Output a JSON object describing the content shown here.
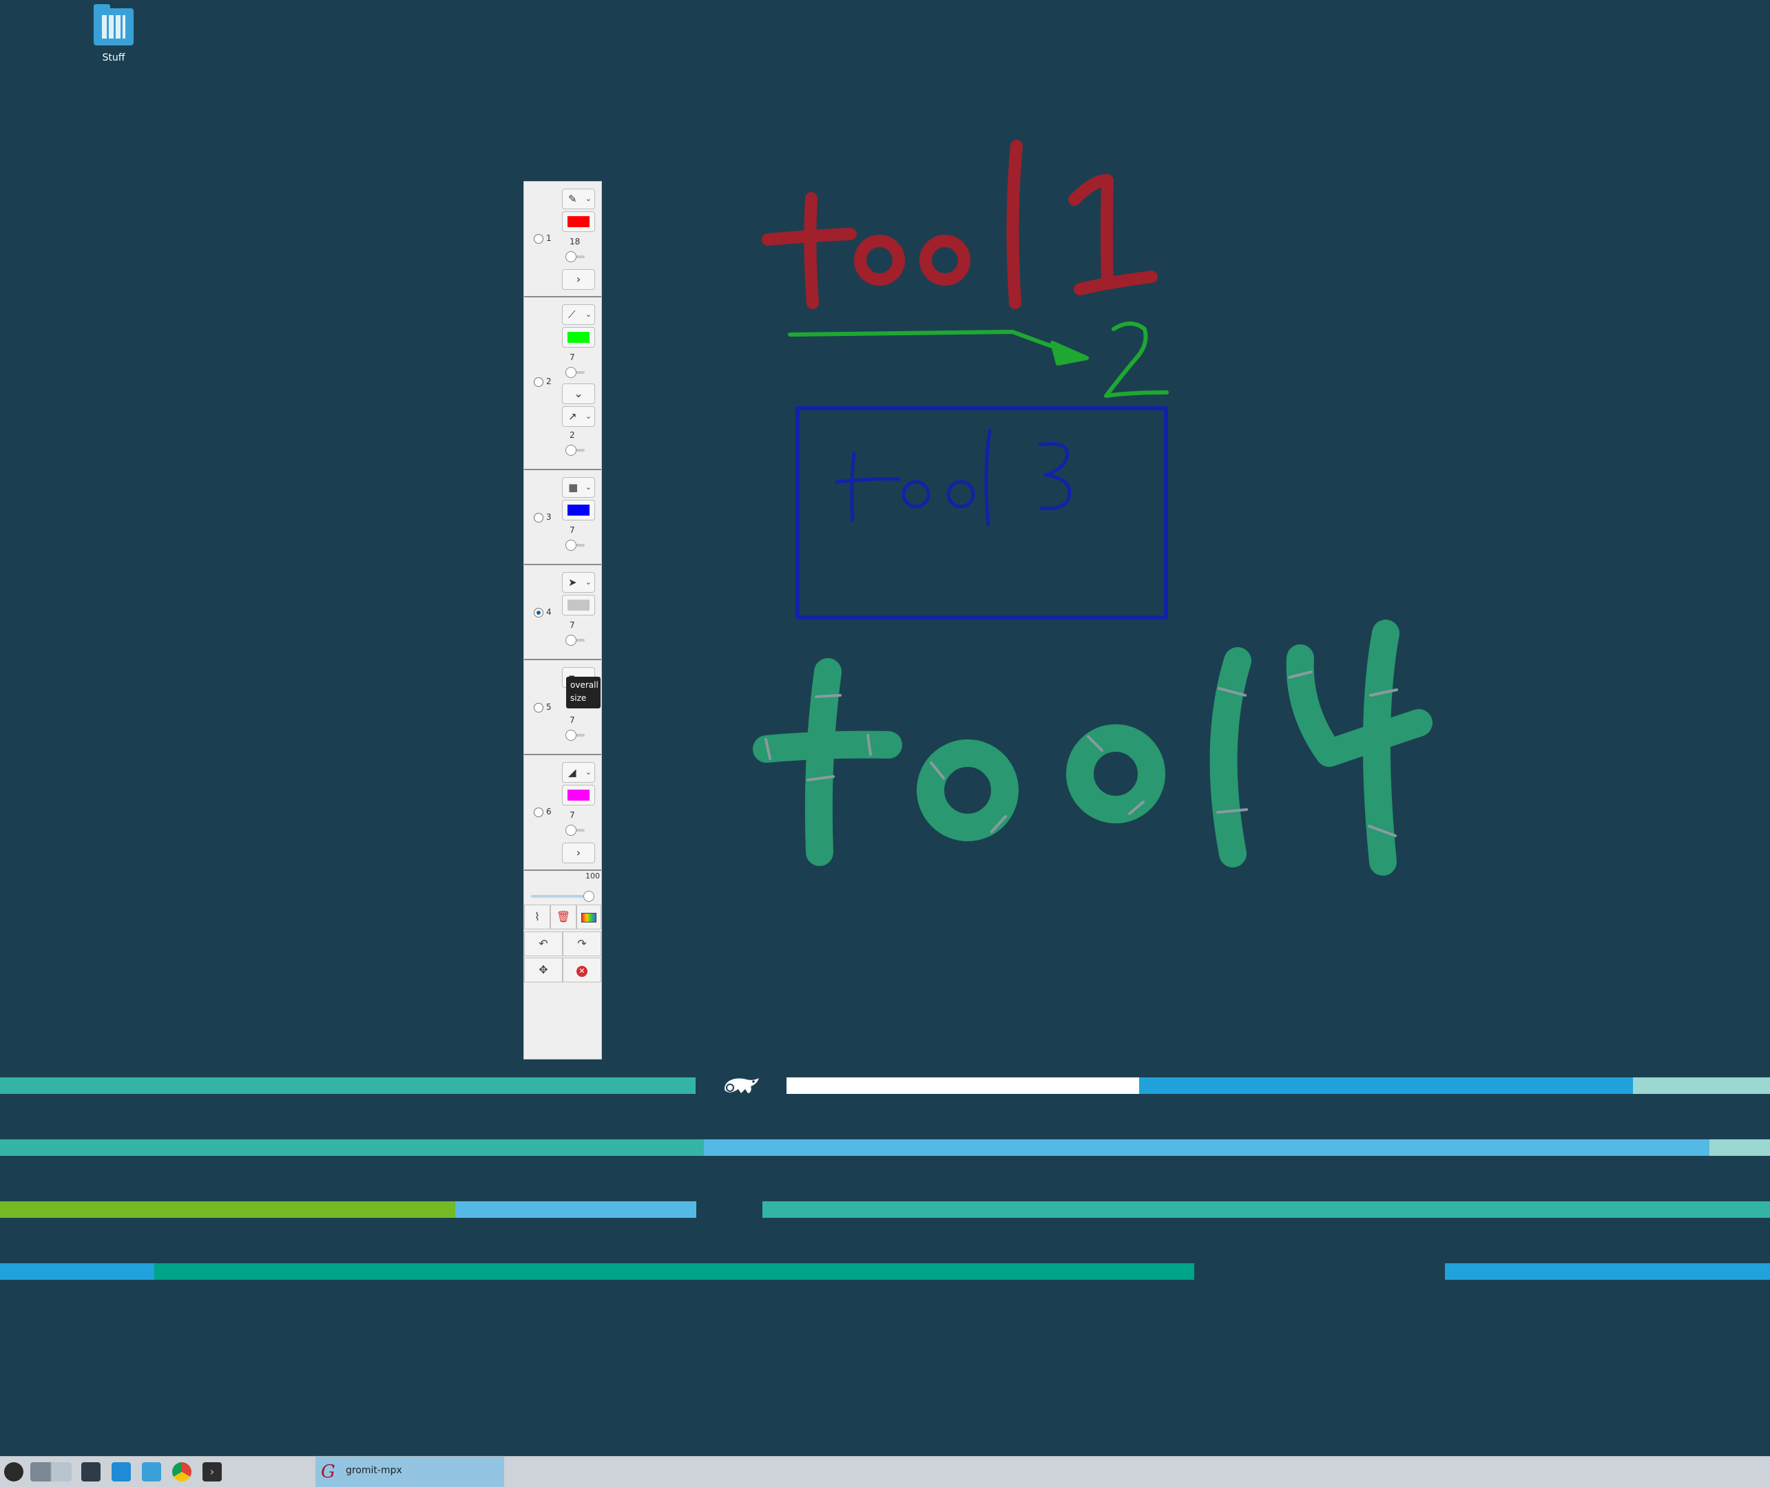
{
  "desktop": {
    "icons": [
      {
        "label": "Stuff",
        "icon": "folder-icon"
      }
    ]
  },
  "drawing": {
    "annotations": [
      {
        "text": "tool1",
        "color": "#a0202c"
      },
      {
        "text": "2",
        "color": "#1ea832"
      },
      {
        "text": "tool 3",
        "color": "#1222a8"
      },
      {
        "text": "tool4",
        "color": "#2a9870"
      }
    ]
  },
  "palette": {
    "title": "gromit-mpx",
    "tools": [
      {
        "number": "1",
        "selected": false,
        "tool_icon": "pen-icon",
        "color": "#ff0000",
        "size": "18",
        "expand_icon": "chevron-right-icon"
      },
      {
        "number": "2",
        "selected": false,
        "tool_icon": "line-icon",
        "color": "#00ff00",
        "size": "7",
        "expand_icon": "chevron-down-icon",
        "sub_tool_icon": "arrow-icon",
        "sub_size": "2"
      },
      {
        "number": "3",
        "selected": false,
        "tool_icon": "rectangle-icon",
        "color": "#0000ff",
        "size": "7"
      },
      {
        "number": "4",
        "selected": true,
        "tool_icon": "cursor-icon",
        "color": "#c6c6c6",
        "size": "7"
      },
      {
        "number": "5",
        "selected": false,
        "tool_icon": "tool-icon",
        "tooltip": "overall size",
        "size": "7"
      },
      {
        "number": "6",
        "selected": false,
        "tool_icon": "eraser-icon",
        "color": "#ff00ff",
        "size": "7",
        "expand_icon": "chevron-right-icon"
      }
    ],
    "opacity": {
      "value": "100",
      "fraction": 1.0
    },
    "actions": [
      {
        "name": "hide-button",
        "icon": "hide-icon"
      },
      {
        "name": "clear-button",
        "icon": "trash-icon"
      },
      {
        "name": "color-button",
        "icon": "palette-icon"
      },
      {
        "name": "undo-button",
        "icon": "undo-icon"
      },
      {
        "name": "redo-button",
        "icon": "redo-icon"
      },
      {
        "name": "move-button",
        "icon": "move-icon"
      },
      {
        "name": "quit-button",
        "icon": "close-icon"
      }
    ]
  },
  "taskbar": {
    "launchers": [
      {
        "icon": "opensuse-menu-icon"
      },
      {
        "icon": "workspace-switcher-icon"
      },
      {
        "icon": "system-settings-icon"
      },
      {
        "icon": "discover-icon"
      },
      {
        "icon": "file-manager-icon"
      },
      {
        "icon": "chrome-icon"
      },
      {
        "icon": "terminal-icon"
      }
    ],
    "tasks": [
      {
        "label": "gromit-mpx",
        "icon": "gromit-icon"
      }
    ]
  },
  "colors": {
    "desktop_bg": "#1b3f50",
    "taskbar_bg": "#cdd3d8",
    "active_task": "#93c5e3",
    "stripe_teal": "#34b4a4",
    "stripe_blue": "#21a2db",
    "stripe_lightblue": "#55b9e6",
    "stripe_green": "#73ba25",
    "stripe_darkteal": "#00a489",
    "stripe_mint": "#9ad8d1"
  }
}
